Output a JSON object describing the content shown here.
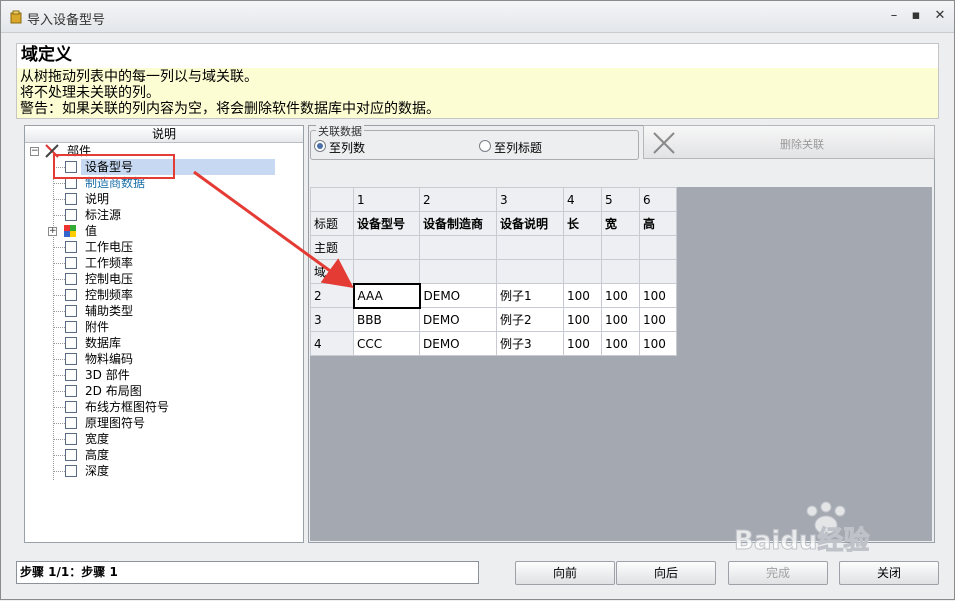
{
  "window": {
    "title": "导入设备型号"
  },
  "header": {
    "title": "域定义",
    "lines": [
      "从树拖动列表中的每一列以与域关联。",
      "将不处理未关联的列。",
      "警告：如果关联的列内容为空，将会删除软件数据库中对应的数据。"
    ]
  },
  "tree": {
    "header": "说明",
    "root": "部件",
    "items": [
      "设备型号",
      "制造商数据",
      "说明",
      "标注源",
      "值",
      "工作电压",
      "工作频率",
      "控制电压",
      "控制频率",
      "辅助类型",
      "附件",
      "数据库",
      "物料编码",
      "3D 部件",
      "2D 布局图",
      "布线方框图符号",
      "原理图符号",
      "宽度",
      "高度",
      "深度"
    ]
  },
  "link_group": {
    "legend": "关联数据",
    "option_columns": "至列数",
    "option_titles": "至列标题",
    "selected": "至列数"
  },
  "delete_button": {
    "label": "删除关联"
  },
  "grid": {
    "col_numbers": [
      "1",
      "2",
      "3",
      "4",
      "5",
      "6"
    ],
    "row_labels": [
      "标题",
      "主题",
      "域"
    ],
    "titles": [
      "设备型号",
      "设备制造商",
      "设备说明",
      "长",
      "宽",
      "高"
    ],
    "rows": [
      {
        "num": "2",
        "cells": [
          "AAA",
          "DEMO",
          "例子1",
          "100",
          "100",
          "100"
        ]
      },
      {
        "num": "3",
        "cells": [
          "BBB",
          "DEMO",
          "例子2",
          "100",
          "100",
          "100"
        ]
      },
      {
        "num": "4",
        "cells": [
          "CCC",
          "DEMO",
          "例子3",
          "100",
          "100",
          "100"
        ]
      }
    ]
  },
  "footer": {
    "status": "步骤 1/1：步骤 1",
    "prev": "向前",
    "next": "向后",
    "finish": "完成",
    "close": "关闭"
  },
  "watermark": {
    "text": "Baidu经验"
  },
  "colors": {
    "highlight": "#e43b34",
    "selection": "#c7d9f2",
    "note_bg": "#fcfdd2"
  }
}
